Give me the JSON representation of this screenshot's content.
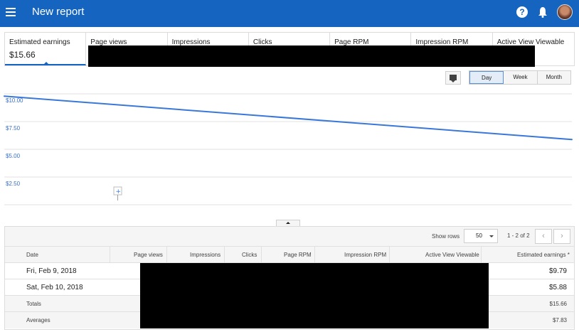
{
  "appbar": {
    "title": "New report",
    "icons": [
      "menu-icon",
      "help-icon",
      "bell-icon",
      "avatar"
    ],
    "color": "#1565c0"
  },
  "metrics": [
    {
      "label": "Estimated earnings",
      "value": "$15.66",
      "active": true
    },
    {
      "label": "Page views",
      "value": ""
    },
    {
      "label": "Impressions",
      "value": ""
    },
    {
      "label": "Clicks",
      "value": ""
    },
    {
      "label": "Page RPM",
      "value": ""
    },
    {
      "label": "Impression RPM",
      "value": ""
    },
    {
      "label": "Active View Viewable",
      "value": ""
    }
  ],
  "range": {
    "options": [
      "Day",
      "Week",
      "Month"
    ],
    "selected": "Day"
  },
  "chart_data": {
    "type": "line",
    "x": [
      "Fri, Feb 9, 2018",
      "Sat, Feb 10, 2018"
    ],
    "series": [
      {
        "values": [
          9.79,
          5.88
        ]
      }
    ],
    "y_tick_labels": [
      "$10.00",
      "$7.50",
      "$5.00",
      "$2.50"
    ],
    "y_ticks": [
      10,
      7.5,
      5,
      2.5
    ],
    "ylim": [
      0,
      10
    ],
    "grid": true,
    "line_color": "#3a78d8",
    "tick_color": "#3a6fc9"
  },
  "table": {
    "show_rows_label": "Show rows",
    "rows_per_page": "50",
    "page_info": "1 - 2 of 2",
    "pager": {
      "prev": "‹",
      "next": "›"
    },
    "columns": [
      "Date",
      "Page views",
      "Impressions",
      "Clicks",
      "Page RPM",
      "Impression RPM",
      "Active View Viewable",
      "Estimated earnings *"
    ],
    "rows": [
      {
        "date": "Fri, Feb 9, 2018",
        "earnings": "$9.79"
      },
      {
        "date": "Sat, Feb 10, 2018",
        "earnings": "$5.88"
      }
    ],
    "totals": {
      "label": "Totals",
      "earnings": "$15.66"
    },
    "averages": {
      "label": "Averages",
      "earnings": "$7.83"
    }
  }
}
